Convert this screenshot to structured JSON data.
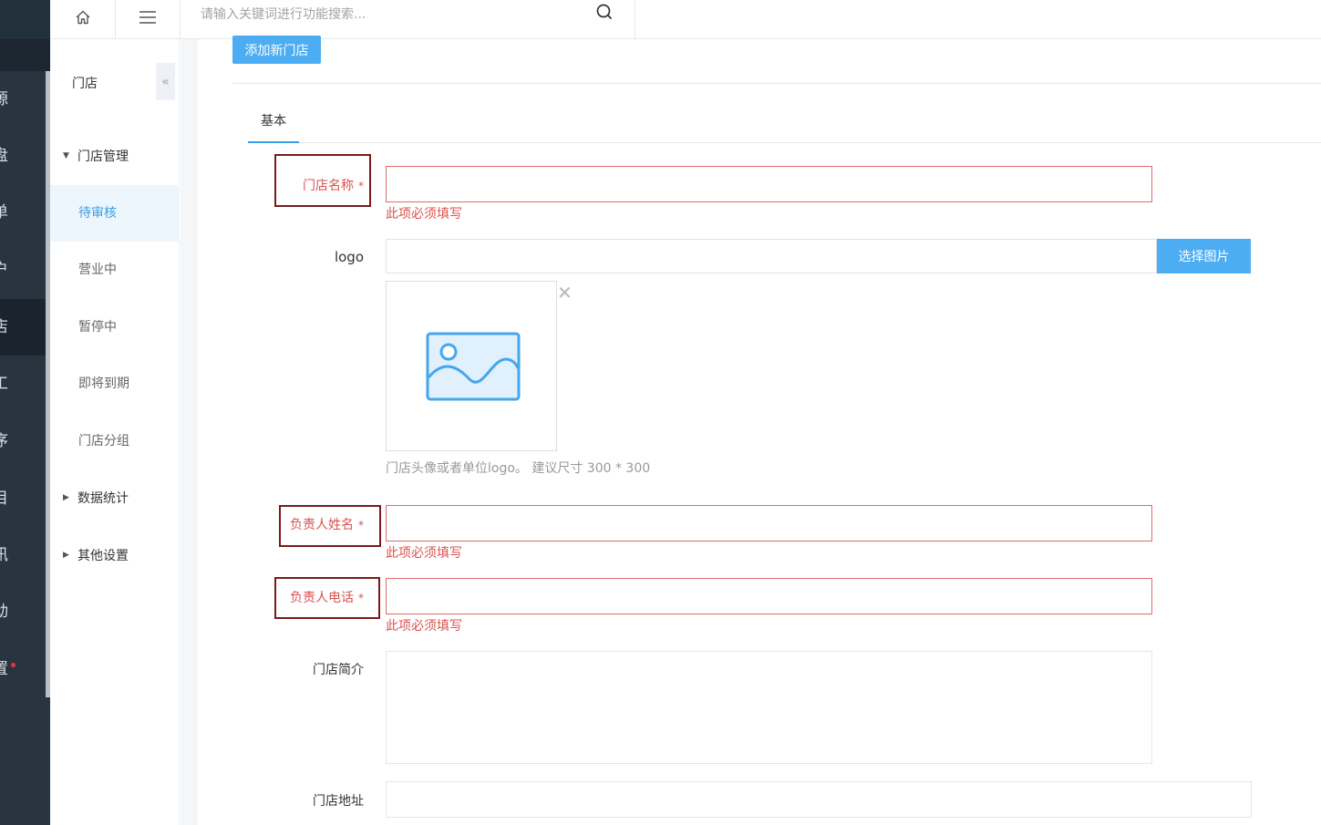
{
  "rail": {
    "items": [
      "源",
      "盘",
      "单",
      "户",
      "店",
      "工",
      "序",
      "目",
      "讯",
      "动",
      "置"
    ]
  },
  "topbar": {
    "home_icon": "home-icon",
    "menu_icon": "menu-icon",
    "search_placeholder": "请输入关键词进行功能搜索...",
    "search_icon": "search-icon"
  },
  "subnav": {
    "title": "门店",
    "collapse_icon": "double-chevron-left-icon",
    "groups": {
      "store_mgmt": "门店管理",
      "stats": "数据统计",
      "other": "其他设置"
    },
    "items": [
      "待审核",
      "营业中",
      "暂停中",
      "即将到期",
      "门店分组"
    ],
    "active_index": 0
  },
  "main": {
    "add_button": "添加新门店",
    "tab": "基本",
    "form": {
      "store_name_label": "门店名称",
      "required_mark": "*",
      "required_error": "此项必须填写",
      "logo_label": "logo",
      "pick_image_button": "选择图片",
      "logo_hint": "门店头像或者单位logo。 建议尺寸 300 * 300",
      "contact_name_label": "负责人姓名",
      "contact_phone_label": "负责人电话",
      "intro_label": "门店简介",
      "address_label": "门店地址"
    }
  },
  "colors": {
    "accent": "#4cadf2",
    "error": "#d9534f",
    "highlight_box": "#7a1a1a",
    "rail_bg": "#283440"
  }
}
